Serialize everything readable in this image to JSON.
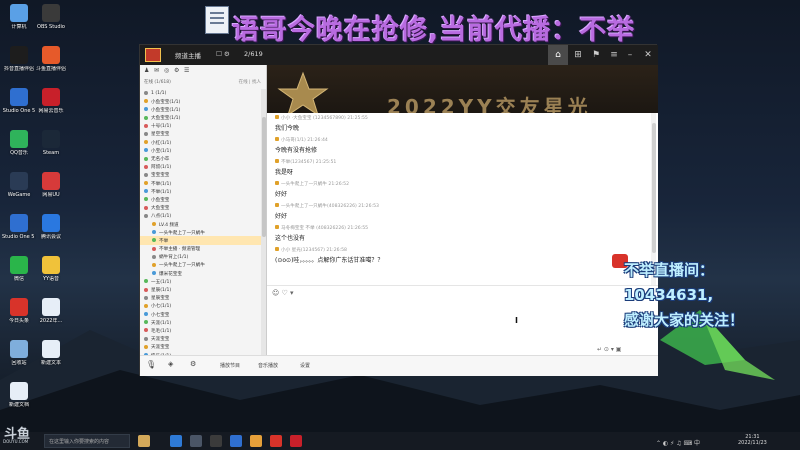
{
  "headline": "语哥今晚在抢修,当前代播：不举",
  "desktop_icons": [
    {
      "label": "计算机",
      "color": "#5aa0e6"
    },
    {
      "label": "OBS Studio",
      "color": "#3a3a3a"
    },
    {
      "label": "抖音直播伴侣",
      "color": "#1d1d1d"
    },
    {
      "label": "斗鱼直播伴侣",
      "color": "#e65a2a"
    },
    {
      "label": "Studio One 5",
      "color": "#2f6fd0"
    },
    {
      "label": "网易云音乐",
      "color": "#c8202a"
    },
    {
      "label": "QQ音乐",
      "color": "#2fb35b"
    },
    {
      "label": "Steam",
      "color": "#1b2838"
    },
    {
      "label": "WeGame",
      "color": "#2a3b55"
    },
    {
      "label": "网易UU",
      "color": "#d73a3a"
    },
    {
      "label": "Studio One 5 (64)",
      "color": "#2f6fd0"
    },
    {
      "label": "腾讯会议",
      "color": "#2a78e0"
    },
    {
      "label": "微信",
      "color": "#2ab54a"
    },
    {
      "label": "YY语音",
      "color": "#f0c23a"
    },
    {
      "label": "今日头条",
      "color": "#d8332a"
    },
    {
      "label": "2022年...",
      "color": "#e6eef7"
    },
    {
      "label": "回收站",
      "color": "#7faedc"
    },
    {
      "label": "新建文本",
      "color": "#e6eef7"
    },
    {
      "label": "新建文档",
      "color": "#e6eef7"
    }
  ],
  "window": {
    "channel_name": "频道主播",
    "member_count": "2/619",
    "banner_text": "2022YY交友星光",
    "sidebar_header_left": "在线 (1/618)",
    "sidebar_header_right": "在线 | 找人",
    "sidebar_users": [
      "1 (1/1)",
      "小鱼宝宝(1/1)",
      "小鱼宝宝(1/1)",
      "大鱼宝宝(1/1)",
      "十号(1/1)",
      "星空宝宝",
      "小红(1/1)",
      "小宝(1/1)",
      "无名小卒",
      "阿叔(1/1)",
      "宝宝宝宝",
      "不举(1/1)",
      "不举(1/1)",
      "小鱼宝宝",
      "大鱼宝宝",
      "八点(1/1)",
      "LV.4 频道",
      "一头牛爬上了一只蜗牛",
      "不举",
      "不举主播 · 频道管理",
      "蜗牛背上(1/1)",
      "一头牛爬上了一只蜗牛",
      "爆米花宝宝",
      "一五(1/1)",
      "星辰(1/1)",
      "星辰宝宝",
      "小七(1/1)",
      "小七宝宝",
      "天涯(1/1)",
      "毛毛(1/1)",
      "天涯宝宝",
      "天涯宝宝",
      "快乐(1/1)",
      "七海(1/1)",
      "七海宝宝"
    ],
    "bottom_bar": [
      "播放节目",
      "音乐播放",
      "设置"
    ],
    "messages": [
      {
        "meta": "小小 ·大鱼宝宝 (1234567890) 21:25:55",
        "body": "我们今晚"
      },
      {
        "meta": "小马哥(1/1) 21:26:44",
        "body": "今晚有没有抢修"
      },
      {
        "meta": "不举(1234567) 21:25:51",
        "body": "我是呀"
      },
      {
        "meta": "一头牛爬上了一只蜗牛 21:26:52",
        "body": "好好"
      },
      {
        "meta": "一头牛爬上了一只蜗牛(408326226) 21:26:53",
        "body": "好好"
      },
      {
        "meta": "马冬梅宝宝 不举 (408326226) 21:26:55",
        "body": "这个也没有"
      },
      {
        "meta": "小小 星光(1234567) 21:26:58",
        "body": "(⊙o⊙)哇，。。。。点解你广东话甘准噶？？"
      }
    ],
    "input_tools": "☺ ♡ ▾",
    "input_bottom": "↵  ⊙ ▾  ▣"
  },
  "overlay": {
    "line1": "不举直播间：",
    "line2": "10434631,",
    "line3": "感谢大家的关注！"
  },
  "taskbar": {
    "logo": "斗鱼",
    "logo_sub": "DOUYU.COM",
    "search_placeholder": "在这里输入你要搜索的内容",
    "time": "21:31",
    "date": "2022/11/23"
  }
}
